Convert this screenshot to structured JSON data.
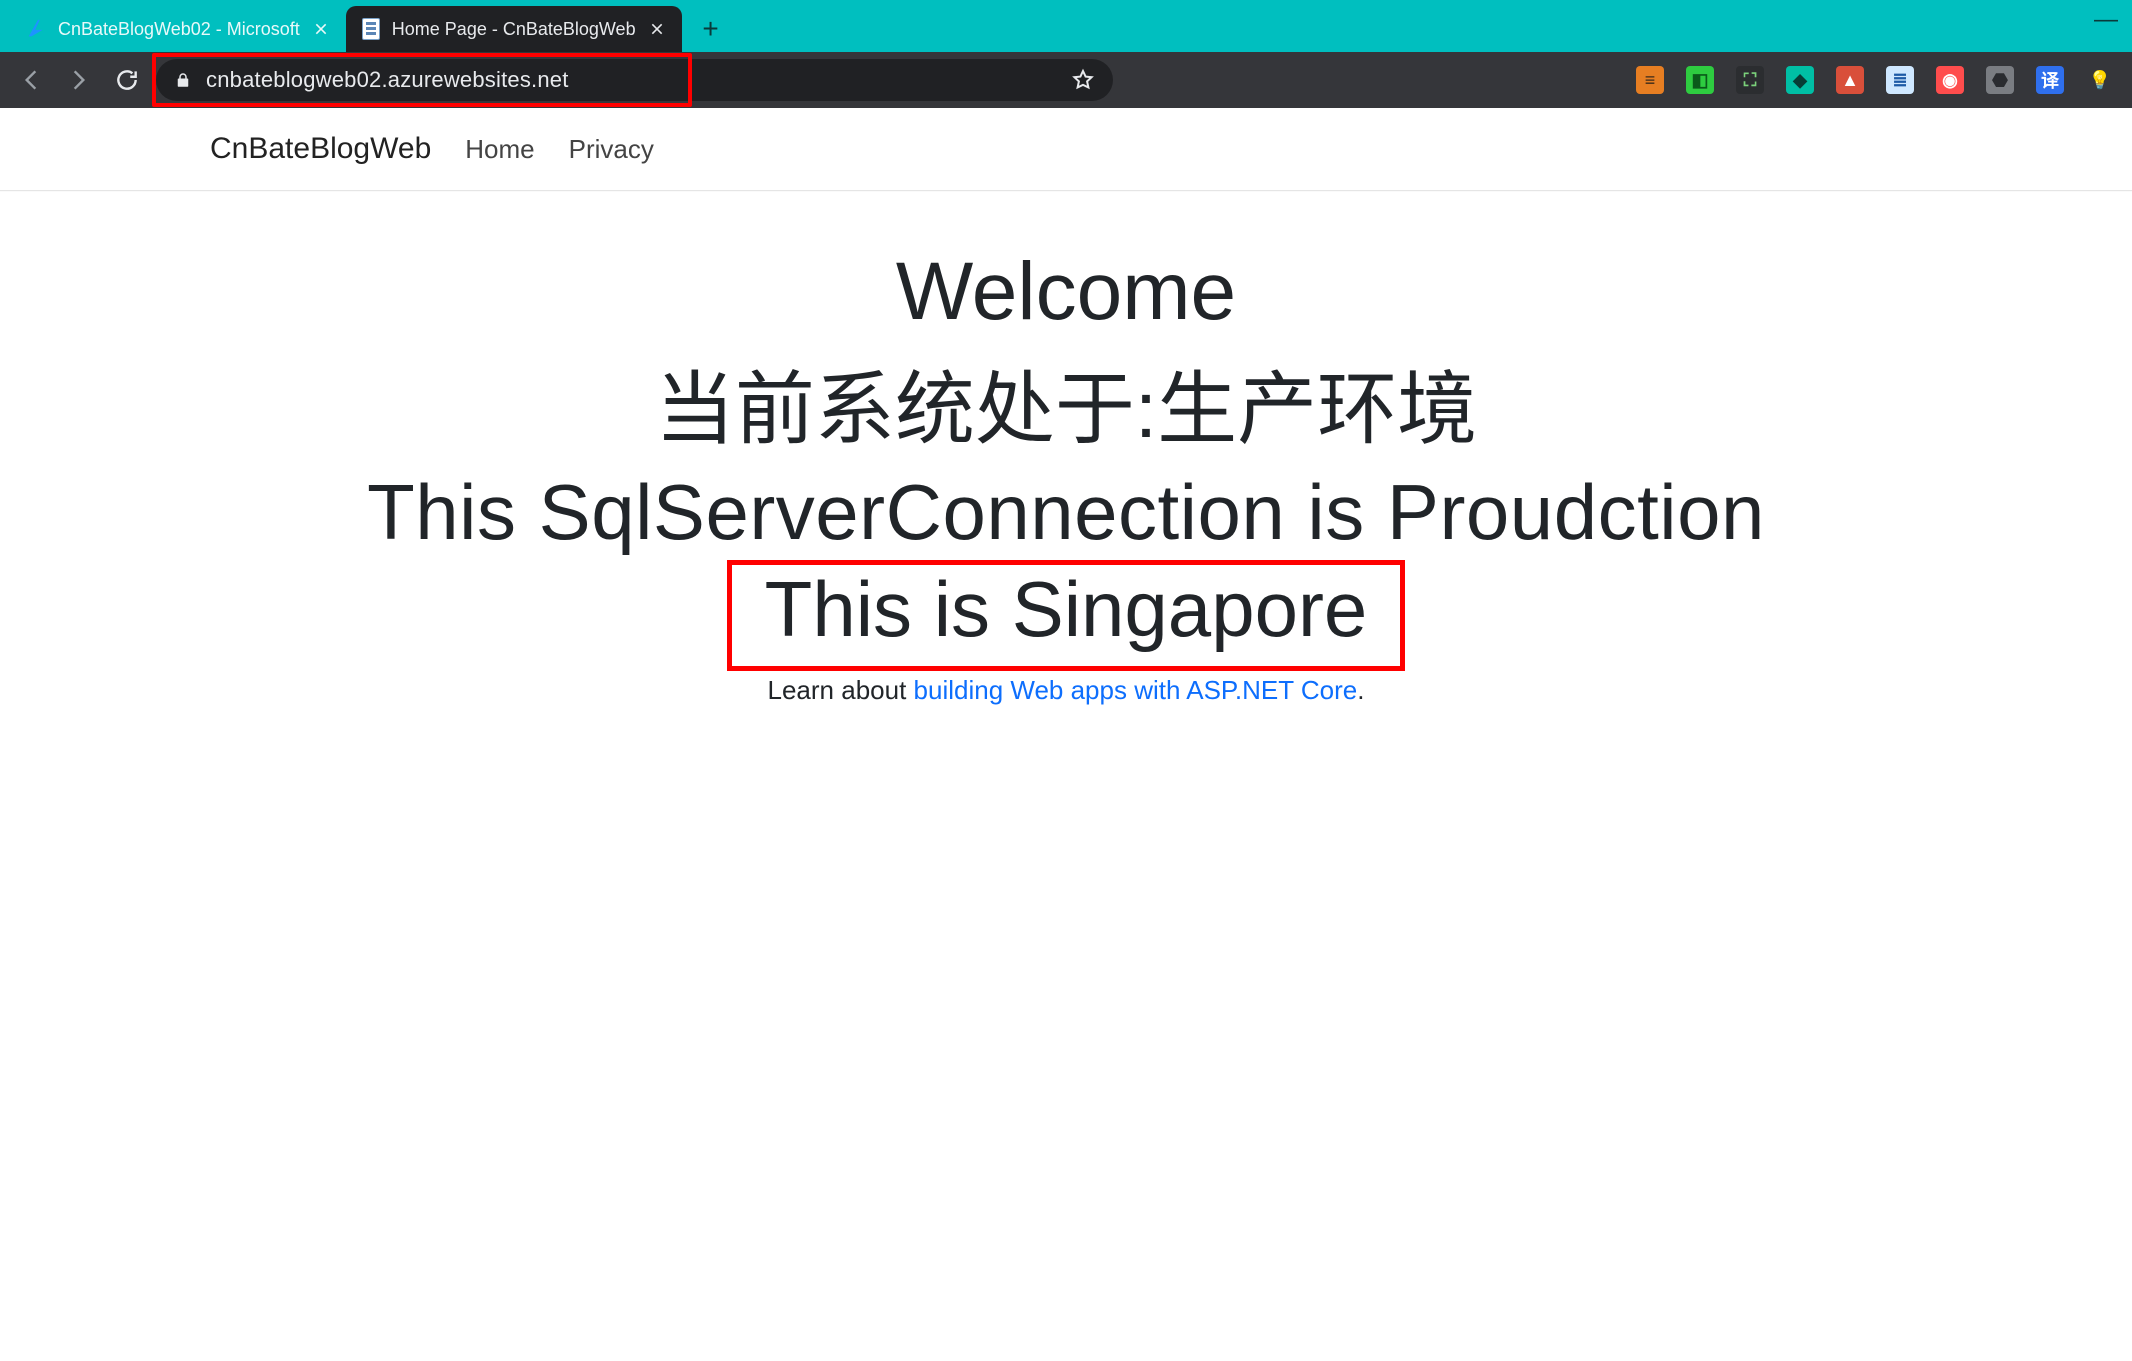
{
  "browser": {
    "tabs": [
      {
        "title": "CnBateBlogWeb02 - Microsoft",
        "active": false,
        "favicon": "azure-icon"
      },
      {
        "title": "Home Page - CnBateBlogWeb",
        "active": true,
        "favicon": "page-icon"
      }
    ],
    "new_tab_glyph": "+",
    "window": {
      "minimize": "—"
    },
    "omnibox": {
      "url": "cnbateblogweb02.azurewebsites.net",
      "secure": true
    },
    "extensions": [
      {
        "name": "extension-1",
        "bg": "#e67e22",
        "fg": "#3b2a1a",
        "glyph": "≡"
      },
      {
        "name": "extension-2",
        "bg": "#2ecc40",
        "fg": "#0a5a1a",
        "glyph": "◧"
      },
      {
        "name": "extension-3",
        "bg": "#2b2d30",
        "fg": "#7bd17b",
        "glyph": "⛶"
      },
      {
        "name": "extension-4",
        "bg": "#00bfa5",
        "fg": "#073d36",
        "glyph": "◆"
      },
      {
        "name": "extension-5",
        "bg": "#d94f3a",
        "fg": "#ffffff",
        "glyph": "▲"
      },
      {
        "name": "extension-6",
        "bg": "#cfe8ff",
        "fg": "#1c5aa6",
        "glyph": "≣"
      },
      {
        "name": "extension-7",
        "bg": "#ff4d4d",
        "fg": "#ffffff",
        "glyph": "◉"
      },
      {
        "name": "extension-8",
        "bg": "#7a7d82",
        "fg": "#2a2c30",
        "glyph": "⬣"
      },
      {
        "name": "extension-9",
        "bg": "#2f6fed",
        "fg": "#ffffff",
        "glyph": "译"
      },
      {
        "name": "extension-10",
        "bg": "transparent",
        "fg": "#bfc3c8",
        "glyph": "💡"
      }
    ]
  },
  "site": {
    "brand": "CnBateBlogWeb",
    "nav": {
      "home": "Home",
      "privacy": "Privacy"
    }
  },
  "content": {
    "welcome": "Welcome",
    "env_line": "当前系统处于:生产环境",
    "conn_line": "This SqlServerConnection is Proudction",
    "loc_line": "This is Singapore",
    "learn_prefix": "Learn about ",
    "learn_link": "building Web apps with ASP.NET Core",
    "learn_suffix": "."
  }
}
